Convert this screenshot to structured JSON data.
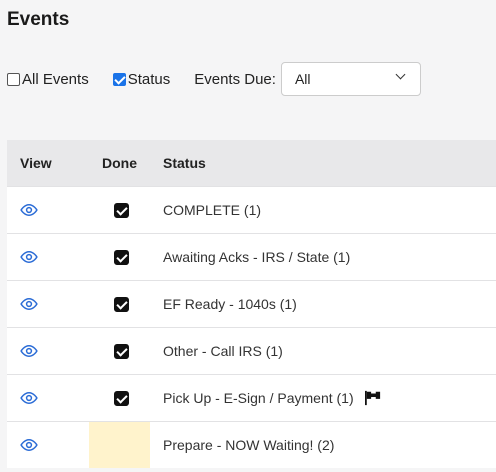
{
  "page": {
    "title": "Events"
  },
  "filters": {
    "all_events": {
      "label": "All Events",
      "checked": false
    },
    "status": {
      "label": "Status",
      "checked": true
    },
    "events_due": {
      "label": "Events Due:",
      "selected": "All"
    }
  },
  "table": {
    "headers": {
      "view": "View",
      "done": "Done",
      "status": "Status"
    },
    "rows": [
      {
        "status": "COMPLETE (1)",
        "done": true,
        "flag": false
      },
      {
        "status": "Awaiting Acks - IRS / State (1)",
        "done": true,
        "flag": false
      },
      {
        "status": "EF Ready - 1040s (1)",
        "done": true,
        "flag": false
      },
      {
        "status": "Other - Call IRS (1)",
        "done": true,
        "flag": false
      },
      {
        "status": "Pick Up - E-Sign / Payment (1)",
        "done": true,
        "flag": true
      },
      {
        "status": "Prepare - NOW Waiting! (2)",
        "done": false,
        "flag": false
      }
    ]
  },
  "colors": {
    "accent": "#2b6cd6",
    "highlight": "#fff3cc"
  },
  "icons": {
    "view": "eye-icon",
    "flag": "flag-icon"
  }
}
